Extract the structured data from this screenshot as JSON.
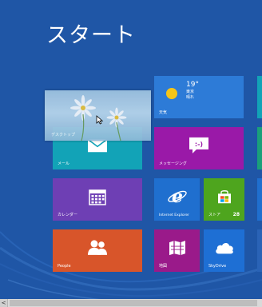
{
  "start": {
    "title": "スタート"
  },
  "colors": {
    "background": "#1f56a6",
    "mail": "#12a3b7",
    "messaging": "#9a19a8",
    "weather": "#2d7bd7",
    "calendar": "#6e3fb4",
    "ie": "#1f6fcf",
    "store": "#4ea51e",
    "people": "#d8552a",
    "maps": "#9a1a8a",
    "skydrive": "#1e6fd4"
  },
  "tiles": {
    "desktop": {
      "label": "デスクトップ",
      "icon": "desktop-wallpaper-daisy"
    },
    "mail": {
      "label": "メール",
      "icon": "envelope-icon"
    },
    "messaging": {
      "label": "メッセージング",
      "icon": "chat-bubble-smiley-icon"
    },
    "weather": {
      "label": "天気",
      "temperature": "19°",
      "city": "東京",
      "condition": "晴れ",
      "icon": "sun-icon"
    },
    "calendar": {
      "label": "カレンダー",
      "icon": "calendar-grid-icon"
    },
    "ie": {
      "label": "Internet Explorer",
      "icon": "ie-logo-icon"
    },
    "store": {
      "label": "ストア",
      "badge": "28",
      "icon": "store-bag-icon"
    },
    "people": {
      "label": "People",
      "icon": "people-icon"
    },
    "maps": {
      "label": "地図",
      "icon": "map-icon"
    },
    "skydrive": {
      "label": "SkyDrive",
      "icon": "cloud-icon"
    }
  },
  "scrollbar": {
    "left_arrow": "<"
  }
}
